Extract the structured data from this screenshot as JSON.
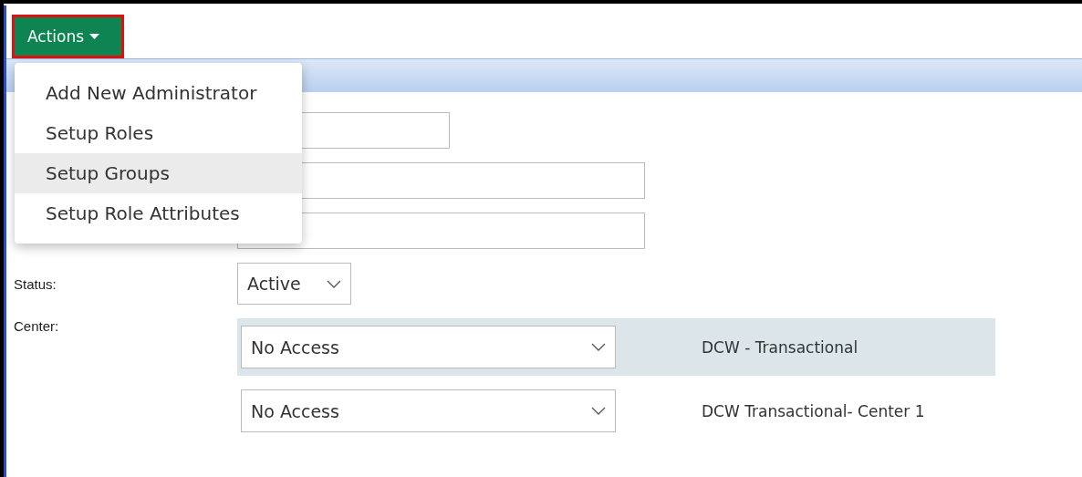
{
  "actions_button": {
    "label": "Actions",
    "highlighted": true
  },
  "actions_menu": {
    "items": [
      {
        "label": "Add New Administrator",
        "selected": false
      },
      {
        "label": "Setup Roles",
        "selected": false
      },
      {
        "label": "Setup Groups",
        "selected": true
      },
      {
        "label": "Setup Role Attributes",
        "selected": false
      }
    ]
  },
  "form": {
    "fields": [
      {
        "kind": "short_text"
      },
      {
        "kind": "text"
      },
      {
        "kind": "text"
      },
      {
        "kind": "select",
        "label": "Status:",
        "value": "Active"
      }
    ],
    "center": {
      "label": "Center:",
      "rows": [
        {
          "value": "No Access",
          "name": "DCW - Transactional",
          "selected": true
        },
        {
          "value": "No Access",
          "name": "DCW Transactional- Center 1",
          "selected": false
        }
      ]
    }
  }
}
